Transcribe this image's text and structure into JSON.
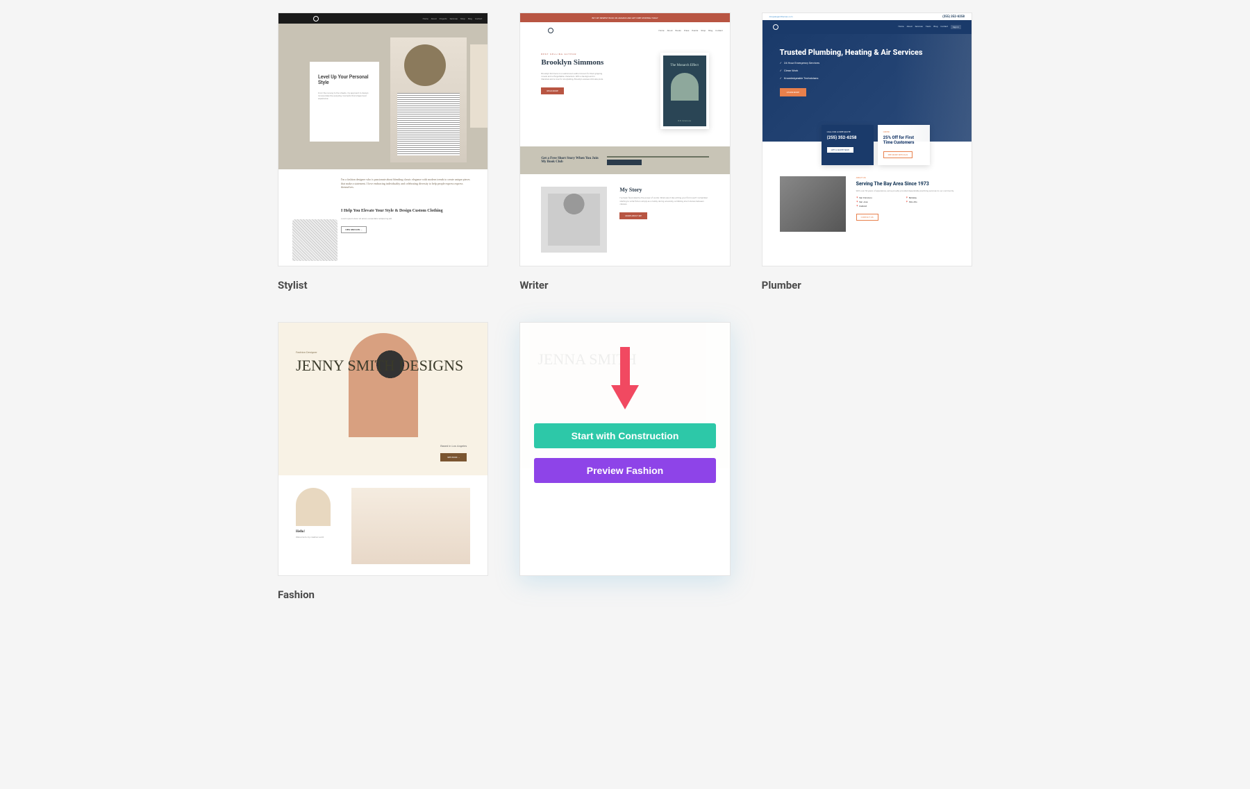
{
  "templates": [
    {
      "id": "stylist",
      "label": "Stylist"
    },
    {
      "id": "writer",
      "label": "Writer"
    },
    {
      "id": "plumber",
      "label": "Plumber"
    },
    {
      "id": "fashion",
      "label": "Fashion"
    }
  ],
  "stylist": {
    "heading": "Level Up Your Personal Style",
    "about": "I'm a fashion designer who is passionate about blending classic elegance with modern trends to create unique pieces that make a statement. I love embracing individuality and celebrating diversity to help people express express themselves.",
    "help_heading": "I Help You Elevate Your Style & Design Custom Clothing"
  },
  "writer": {
    "tag": "BEST SELLING AUTHOR",
    "name": "Brooklyn Simmons",
    "book_title": "The Monarch Effect",
    "book_author": "B.B. Simmons",
    "signup": "Get a Free Short Story When You Join My Book Club",
    "story_heading": "My Story"
  },
  "plumber": {
    "phone": "(255) 352-6258",
    "heading": "Trusted Plumbing, Heating & Air Services",
    "checks": [
      "24 Hour Emergency Services",
      "Clean Work",
      "Knowledgeable Technicians"
    ],
    "card_phone": "(255) 352-6258",
    "card_offer": "25% Off for First Time Customers",
    "serving": "Serving The Bay Area Since 1973",
    "cities": [
      "San Francisco",
      "Berkeley",
      "San Jose",
      "Palo Alto",
      "Oakland"
    ]
  },
  "fashion": {
    "tag": "Fashion Designer",
    "heading": "JENNY SMITH DESIGNS",
    "location": "Based in Los Angeles",
    "hello": "Hello!"
  },
  "hovered": {
    "ghost_heading": "JENNA SMITH",
    "start_button": "Start with Construction",
    "preview_button": "Preview Fashion"
  },
  "colors": {
    "arrow": "#f14961",
    "start": "#2dc8a8",
    "preview": "#8e44e8"
  }
}
